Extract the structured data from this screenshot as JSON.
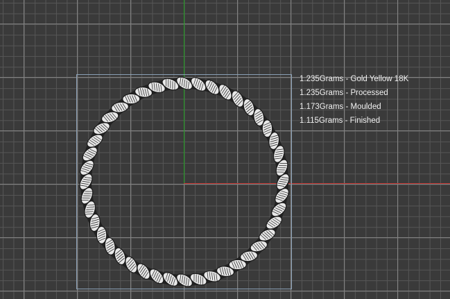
{
  "colors": {
    "background": "#3a3a3a",
    "grid_major": "#838383",
    "grid_minor": "#565656",
    "axis_x": "#c0302c",
    "axis_y": "#1ea01e",
    "bounding_box": "#8aa0b6",
    "label_text": "#f2f2f2",
    "rope_fill": "#e8e8e8",
    "rope_stroke": "#1a1a1a"
  },
  "weights": [
    "1.235Grams - Gold Yellow 18K",
    "1.235Grams - Processed",
    "1.173Grams - Moulded",
    "1.115Grams - Finished"
  ],
  "model": {
    "name_icon": "twisted-rope-ring-icon"
  }
}
